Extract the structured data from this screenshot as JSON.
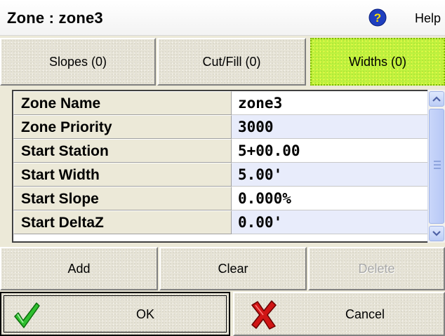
{
  "window": {
    "title": "Zone : zone3",
    "help_label": "Help",
    "help_icon": "question-mark-icon"
  },
  "tabs": [
    {
      "label": "Slopes (0)",
      "active": false
    },
    {
      "label": "Cut/Fill (0)",
      "active": false
    },
    {
      "label": "Widths (0)",
      "active": true
    }
  ],
  "colors": {
    "active_tab": "#bff23f",
    "grid_alt_row": "#e8ecfb",
    "ok_check": "#22aa22",
    "cancel_x": "#cc1111"
  },
  "properties": [
    {
      "name": "Zone Name",
      "value": "zone3"
    },
    {
      "name": "Zone Priority",
      "value": "3000"
    },
    {
      "name": "Start Station",
      "value": "5+00.00"
    },
    {
      "name": "Start Width",
      "value": "5.00'"
    },
    {
      "name": "Start Slope",
      "value": "0.000%"
    },
    {
      "name": "Start DeltaZ",
      "value": "0.00'"
    }
  ],
  "actions": {
    "add": "Add",
    "clear": "Clear",
    "delete": "Delete"
  },
  "dialog": {
    "ok": "OK",
    "cancel": "Cancel"
  }
}
